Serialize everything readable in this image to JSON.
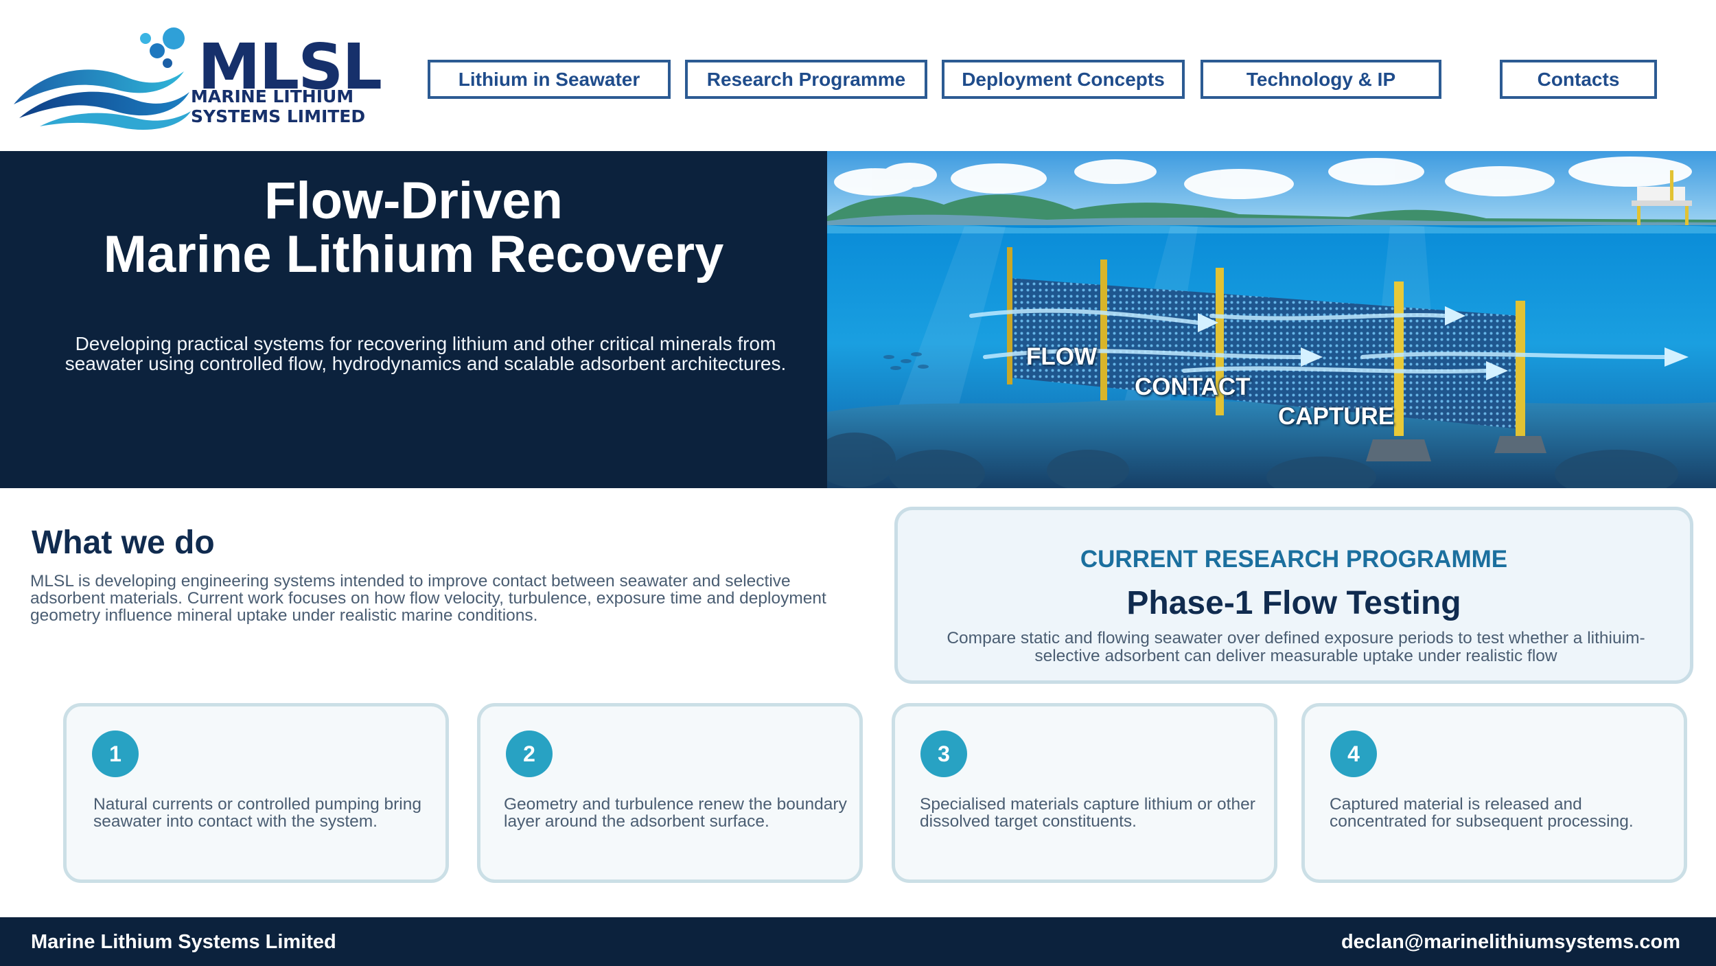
{
  "brand": {
    "abbr": "MLSL",
    "name": "MARINE LITHIUM\nSYSTEMS LIMITED",
    "primary_color": "#16306b",
    "accent_color": "#28a2c3"
  },
  "nav": {
    "items": [
      {
        "label": "Lithium in Seawater"
      },
      {
        "label": "Research Programme"
      },
      {
        "label": "Deployment Concepts"
      },
      {
        "label": "Technology & IP"
      },
      {
        "label": "Contacts"
      }
    ]
  },
  "hero": {
    "title_line1": "Flow-Driven",
    "title_line2": "Marine Lithium Recovery",
    "subtitle": "Developing practical systems for recovering lithium and other critical minerals from seawater using controlled flow, hydrodynamics and scalable adsorbent architectures.",
    "image_labels": {
      "flow": "FLOW",
      "contact": "CONTACT",
      "capture": "CAPTURE"
    }
  },
  "what_we_do": {
    "title": "What we do",
    "text": "MLSL is developing engineering systems intended to improve contact between seawater and selective adsorbent materials. Current work focuses on how flow velocity, turbulence, exposure time and deployment geometry influence mineral uptake under realistic marine conditions."
  },
  "research": {
    "kicker": "CURRENT RESEARCH PROGRAMME",
    "title": "Phase-1 Flow Testing",
    "description": "Compare static and flowing seawater over defined exposure periods to test whether a lithiuim-selective adsorbent can deliver measurable uptake under realistic flow"
  },
  "steps": [
    {
      "number": "1",
      "text": "Natural currents or controlled pumping bring seawater into contact with the system."
    },
    {
      "number": "2",
      "text": "Geometry and turbulence renew the boundary layer around the adsorbent surface."
    },
    {
      "number": "3",
      "text": "Specialised materials capture lithium or other dissolved target constituents."
    },
    {
      "number": "4",
      "text": "Captured material is released and concentrated for subsequent processing."
    }
  ],
  "footer": {
    "company": "Marine Lithium Systems Limited",
    "email": "declan@marinelithiumsystems.com"
  }
}
